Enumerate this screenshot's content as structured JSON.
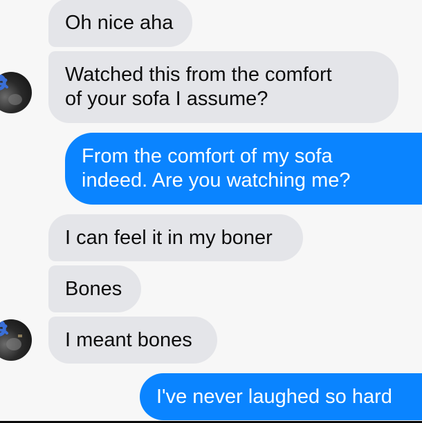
{
  "messages": [
    {
      "text": "Oh nice aha",
      "direction": "incoming"
    },
    {
      "text": "Watched this from the comfort\nof your sofa I assume?",
      "direction": "incoming"
    },
    {
      "text": "From the comfort of my sofa\nindeed. Are you watching me?",
      "direction": "outgoing"
    },
    {
      "text": "I can feel it in my boner",
      "direction": "incoming"
    },
    {
      "text": "Bones",
      "direction": "incoming"
    },
    {
      "text": "I meant bones",
      "direction": "incoming"
    },
    {
      "text": "I've never laughed so hard",
      "direction": "outgoing"
    }
  ],
  "colors": {
    "background": "#f7f7f7",
    "incoming_bubble": "#e4e5e9",
    "outgoing_bubble": "#0a84ff",
    "incoming_text": "#0c0c0c",
    "outgoing_text": "#ffffff"
  },
  "avatars": [
    {
      "icon": "contact-avatar",
      "note": "partially scribbled out in blue"
    },
    {
      "icon": "contact-avatar",
      "note": "partially scribbled out in blue"
    }
  ]
}
